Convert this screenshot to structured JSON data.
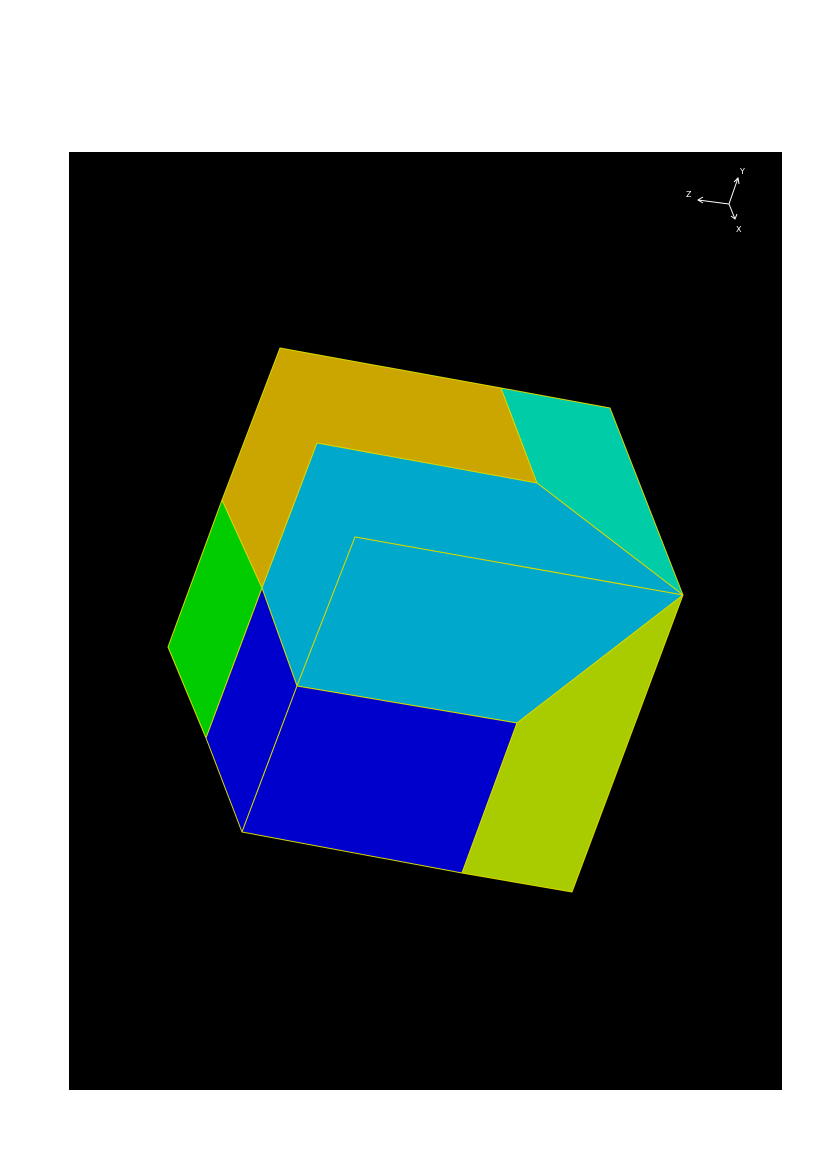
{
  "viewport": {
    "background": "#000000"
  },
  "axes_triad": {
    "labels": {
      "y": "Y",
      "z": "Z",
      "x": "X"
    },
    "color": "#ffffff"
  },
  "cube": {
    "edge_color": "#d8d800",
    "face_colors": {
      "top_left": "#cba600",
      "top_right": "#00cca8",
      "upper_inner": "#00a8cc",
      "lower_inner": "#00a8cc",
      "left_upper": "#00cc00",
      "left_lower": "#0000cc",
      "bottom_front": "#0000cc",
      "right_lower": "#a8cc00"
    }
  }
}
